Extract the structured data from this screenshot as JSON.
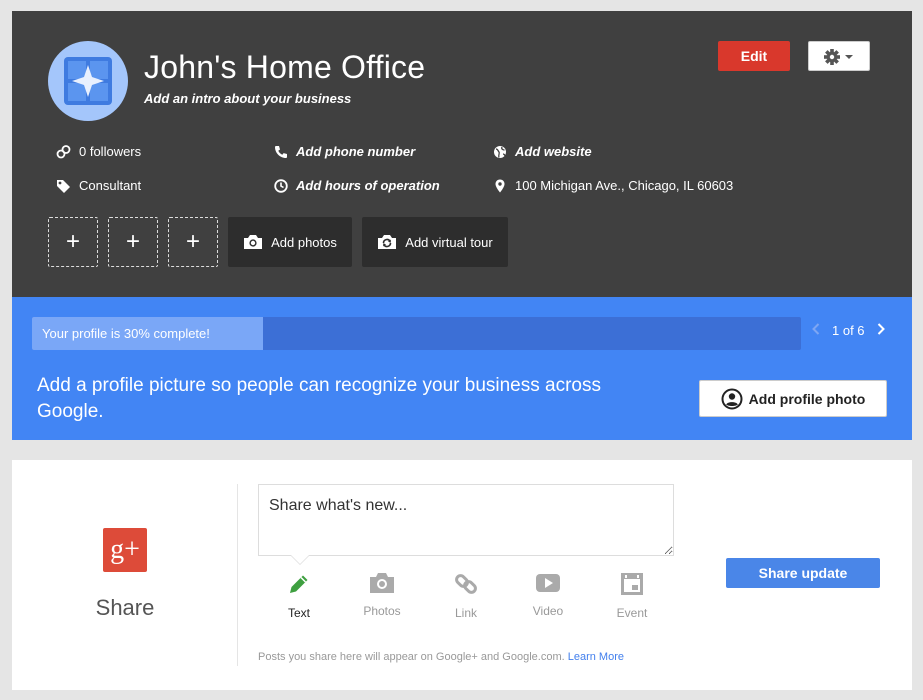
{
  "header": {
    "business_name": "John's Home Office",
    "intro_prompt": "Add an intro about your business",
    "edit_label": "Edit",
    "info": {
      "followers": "0 followers",
      "category": "Consultant",
      "phone": "Add phone number",
      "hours": "Add hours of operation",
      "website": "Add website",
      "address": "100 Michigan Ave., Chicago, IL 60603"
    },
    "photo_slots": [
      "+",
      "+",
      "+"
    ],
    "add_photos_label": "Add photos",
    "add_tour_label": "Add virtual tour"
  },
  "completion": {
    "progress_text": "Your profile is 30% complete!",
    "percent": 30,
    "pager_text": "1 of 6",
    "prompt": "Add a profile picture so people can recognize your business across Google.",
    "add_photo_label": "Add profile photo"
  },
  "share": {
    "logo_text": "g+",
    "title": "Share",
    "placeholder": "Share what's new...",
    "options": [
      {
        "label": "Text",
        "icon": "pencil-icon",
        "active": true
      },
      {
        "label": "Photos",
        "icon": "camera-icon",
        "active": false
      },
      {
        "label": "Link",
        "icon": "link-icon",
        "active": false
      },
      {
        "label": "Video",
        "icon": "video-icon",
        "active": false
      },
      {
        "label": "Event",
        "icon": "event-icon",
        "active": false
      }
    ],
    "update_label": "Share update",
    "note_text": "Posts you share here will appear on Google+ and Google.com.",
    "learn_more": "Learn More"
  },
  "colors": {
    "header_bg": "#404040",
    "blue_panel": "#4285f4",
    "edit_red": "#d9382c",
    "gplus_red": "#dd4b39",
    "text_option_green": "#3e9f40"
  }
}
